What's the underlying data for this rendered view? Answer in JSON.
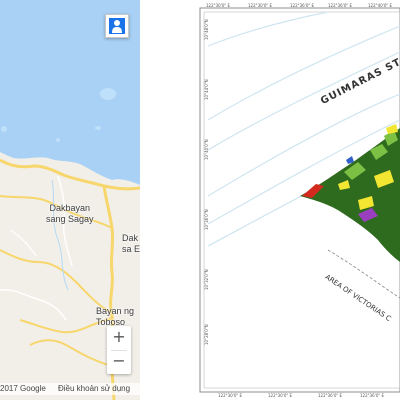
{
  "road_map": {
    "labels": {
      "sagay_line1": "Dakbayan",
      "sagay_line2": "sang Sagay",
      "escalante_line1": "Dak",
      "escalante_line2": "sa Es",
      "toboso_line1": "Bayan ng",
      "toboso_line2": "Toboso"
    },
    "zoom_in": "+",
    "zoom_out": "−",
    "pegman_icon": "person-icon",
    "attribution": {
      "copyright": "2017 Google",
      "terms": "Điều khoản sử dụng"
    },
    "colors": {
      "water": "#a8d1f5",
      "land": "#f2efe9",
      "road": "#f7d66b",
      "pegman": "#1a73e8"
    }
  },
  "thematic_map": {
    "strait_label": "GUIMARAS ST",
    "area_label": "AREA OF VICTORIAS C",
    "coordinates_top": [
      "122°30'0\" E",
      "122°30'0\" E",
      "122°36'0\" E",
      "122°36'0\" E",
      "122°40'0\" E"
    ],
    "coordinates_bottom": [
      "122°30'0\" E",
      "122°30'0\" E",
      "122°36'0\" E",
      "122°36'0\" E"
    ],
    "coordinates_left": [
      "10°48'0\"N",
      "10°44'0\"N",
      "10°40'0\"N",
      "10°36'0\"N",
      "10°32'0\"N",
      "10°28'0\"N"
    ],
    "colors": {
      "forest": "#2f6b1f",
      "light_green": "#7cc044",
      "yellow": "#f2e632",
      "red": "#d22a1e",
      "purple": "#9a3fc0",
      "blue": "#3060c8",
      "bathymetry": "#cfe6f0"
    }
  }
}
